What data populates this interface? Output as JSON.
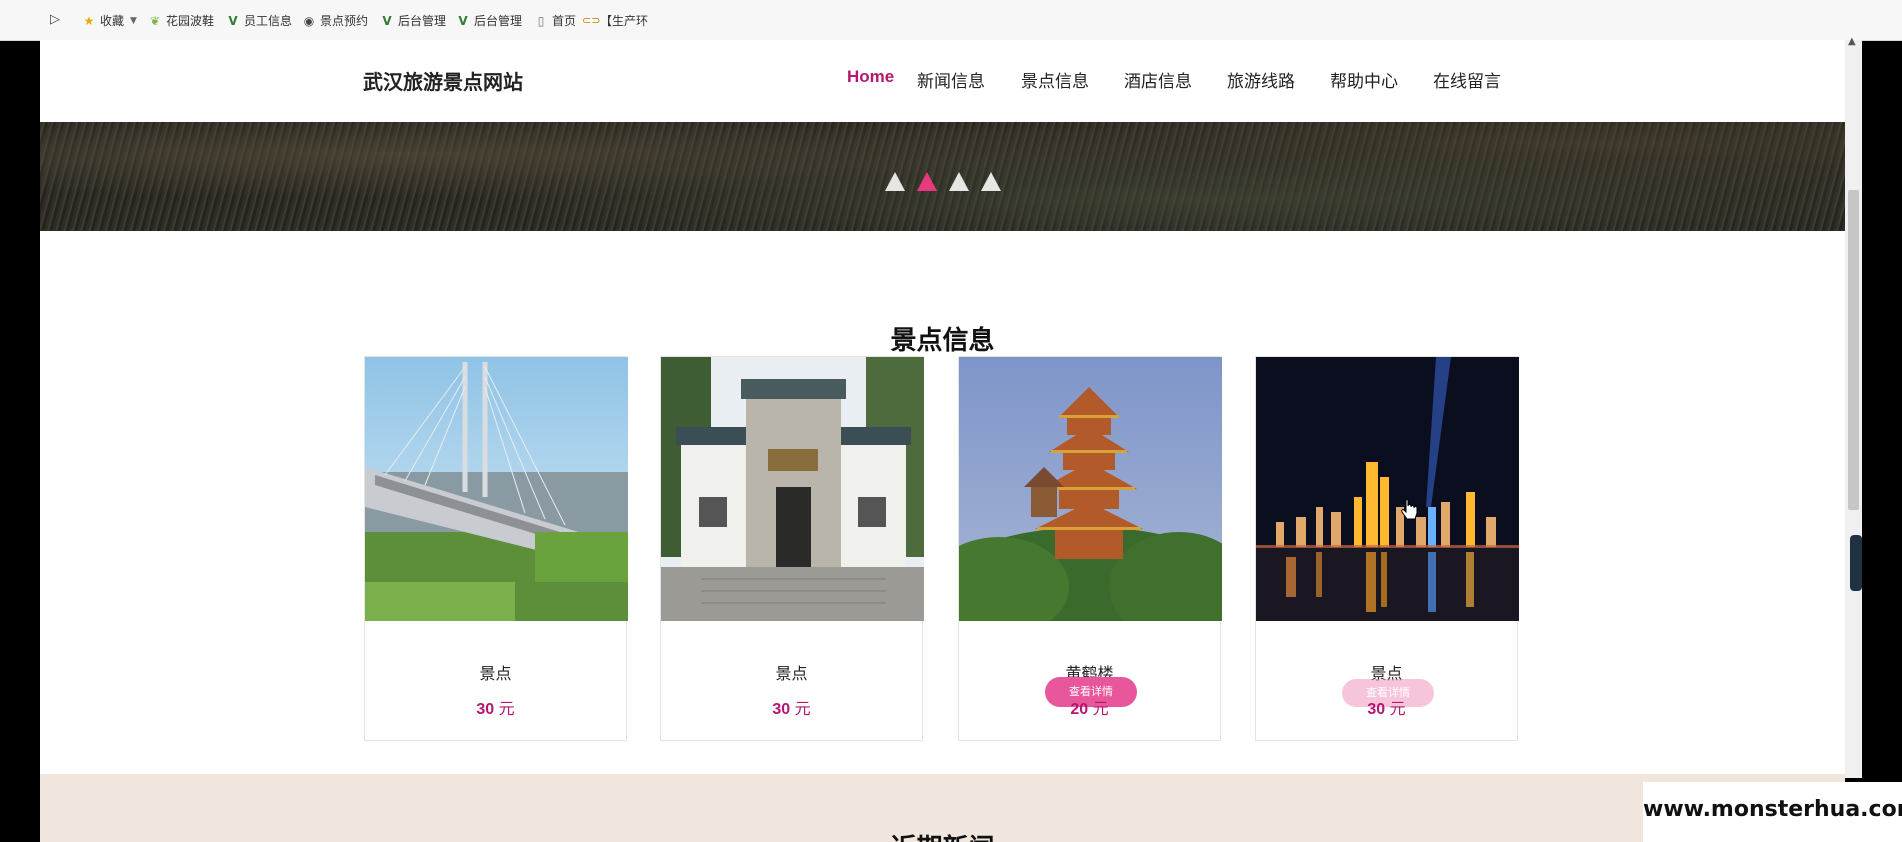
{
  "bookmarks": {
    "items": [
      {
        "icon": "star-icon",
        "label": "收藏",
        "has_dropdown": true
      },
      {
        "icon": "leaf-icon",
        "label": "花园波鞋"
      },
      {
        "icon": "v-logo-icon",
        "label": "员工信息"
      },
      {
        "icon": "bell-icon",
        "label": "景点预约"
      },
      {
        "icon": "v-logo-icon",
        "label": "后台管理"
      },
      {
        "icon": "v-logo-icon",
        "label": "后台管理"
      },
      {
        "icon": "document-icon",
        "label": "首页"
      },
      {
        "icon": "link-icon",
        "label": "【生产环"
      }
    ]
  },
  "site": {
    "title": "武汉旅游景点网站",
    "nav": [
      "Home",
      "新闻信息",
      "景点信息",
      "酒店信息",
      "旅游线路",
      "帮助中心",
      "在线留言"
    ],
    "active_nav": 0,
    "accent_color": "#b5176f"
  },
  "banner": {
    "slides": 4,
    "active_slide": 1
  },
  "attractions": {
    "title": "景点信息",
    "cards": [
      {
        "image": "bridge-photo",
        "name": "景点",
        "price": "30",
        "unit": "元"
      },
      {
        "image": "gate-photo",
        "name": "景点",
        "price": "30",
        "unit": "元"
      },
      {
        "image": "yellow-crane-tower-photo",
        "name": "黄鹤楼",
        "price": "20",
        "unit": "元",
        "button": "查看详情"
      },
      {
        "image": "night-skyline-photo",
        "name": "景点",
        "price": "30",
        "unit": "元",
        "button": "查看详情"
      }
    ]
  },
  "news": {
    "title": "近期新闻"
  },
  "watermark": "www.monsterhua.com"
}
